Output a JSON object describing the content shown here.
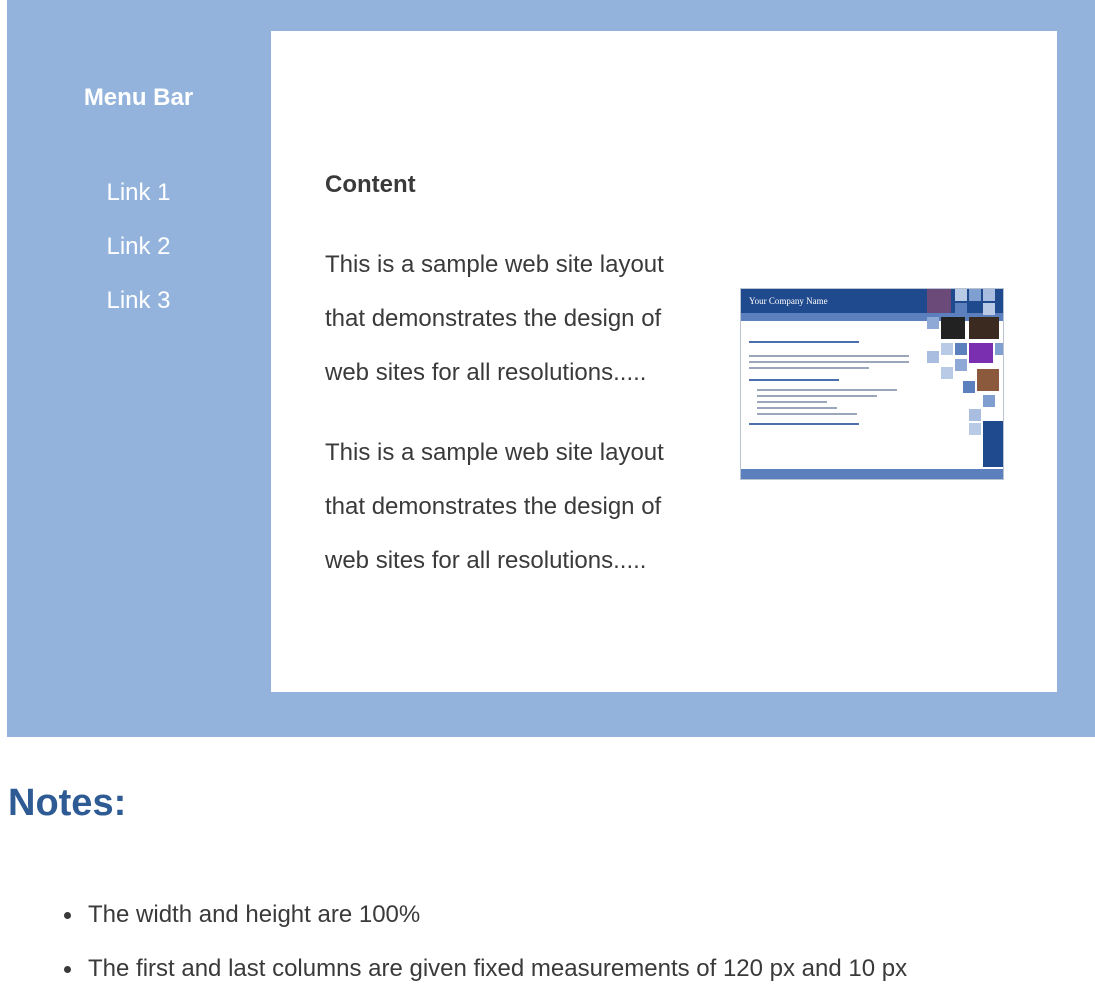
{
  "menu": {
    "title": "Menu Bar",
    "links": [
      "Link 1",
      "Link 2",
      "Link 3"
    ]
  },
  "content": {
    "title": "Content",
    "paragraphs": [
      "This is a sample web site layout that demonstrates the design of web sites for all resolutions.....",
      "This is a sample web site layout that demonstrates the design of web sites for all resolutions....."
    ],
    "thumbnail": {
      "header_text": "Your Company Name"
    }
  },
  "notes": {
    "title": "Notes:",
    "items": [
      "The width and height are 100%",
      "The first and last columns are given fixed measurements of 120 px and 10 px"
    ]
  },
  "colors": {
    "layout_background": "#93b3dd",
    "content_background": "#ffffff",
    "notes_heading": "#2e5b94",
    "body_text": "#3a3a3a"
  }
}
